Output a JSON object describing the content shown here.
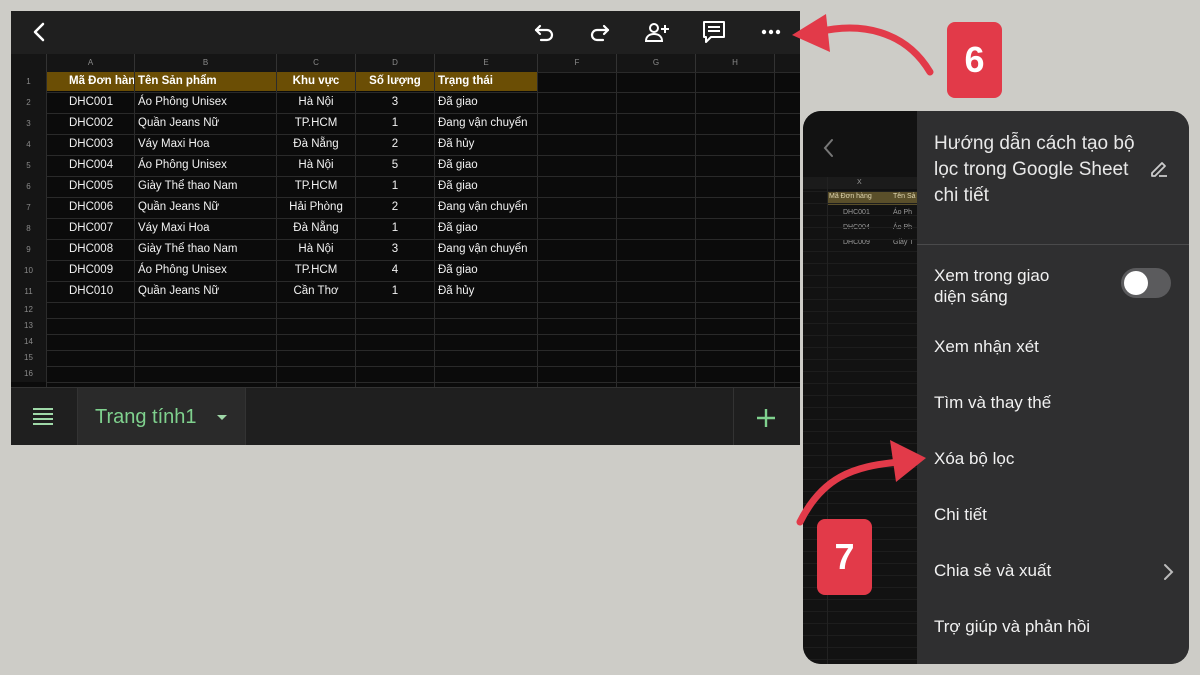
{
  "sheet": {
    "column_letters": [
      "A",
      "B",
      "C",
      "D",
      "E",
      "F",
      "G",
      "H"
    ],
    "headers": [
      "Mã Đơn hàng",
      "Tên Sản phẩm",
      "Khu vực",
      "Số lượng",
      "Trạng thái"
    ],
    "rows": [
      [
        "DHC001",
        "Áo Phông Unisex",
        "Hà Nội",
        "3",
        "Đã giao"
      ],
      [
        "DHC002",
        "Quần Jeans Nữ",
        "TP.HCM",
        "1",
        "Đang vận chuyển"
      ],
      [
        "DHC003",
        "Váy Maxi Hoa",
        "Đà Nẵng",
        "2",
        "Đã hủy"
      ],
      [
        "DHC004",
        "Áo Phông Unisex",
        "Hà Nội",
        "5",
        "Đã giao"
      ],
      [
        "DHC005",
        "Giày Thể thao Nam",
        "TP.HCM",
        "1",
        "Đã giao"
      ],
      [
        "DHC006",
        "Quần Jeans Nữ",
        "Hải Phòng",
        "2",
        "Đang vận chuyển"
      ],
      [
        "DHC007",
        "Váy Maxi Hoa",
        "Đà Nẵng",
        "1",
        "Đã giao"
      ],
      [
        "DHC008",
        "Giày Thể thao Nam",
        "Hà Nội",
        "3",
        "Đang vận chuyển"
      ],
      [
        "DHC009",
        "Áo Phông Unisex",
        "TP.HCM",
        "4",
        "Đã giao"
      ],
      [
        "DHC010",
        "Quần Jeans Nữ",
        "Cần Thơ",
        "1",
        "Đã hủy"
      ]
    ],
    "row_numbers": [
      "1",
      "2",
      "3",
      "4",
      "5",
      "6",
      "7",
      "8",
      "9",
      "10",
      "11",
      "12",
      "13",
      "14",
      "15",
      "16"
    ],
    "tab_name": "Trang tính1",
    "header_fill": "#6b4e05"
  },
  "toolbar": {
    "icons": [
      "back-icon",
      "undo-icon",
      "redo-icon",
      "add-person-icon",
      "comment-icon",
      "more-icon"
    ]
  },
  "menu": {
    "doc_title": "Hướng dẫn cách tạo bộ lọc trong Google Sheet chi tiết",
    "items": [
      "Xem trong giao diện sáng",
      "Xem nhận xét",
      "Tìm và thay thế",
      "Xóa bộ lọc",
      "Chi tiết",
      "Chia sẻ và xuất",
      "Trợ giúp và phản hồi"
    ],
    "light_mode_toggle_on": false,
    "mini_sheet": {
      "col_letter": "X",
      "headers": [
        "Mã Đơn hàng",
        "Tên Sả"
      ],
      "rows": [
        [
          "DHC001",
          "Áo Ph"
        ],
        [
          "DHC004",
          "Áo Ph"
        ],
        [
          "DHC009",
          "Giày T"
        ]
      ]
    }
  },
  "annotations": {
    "step_6": "6",
    "step_7": "7",
    "accent": "#e23a49"
  }
}
